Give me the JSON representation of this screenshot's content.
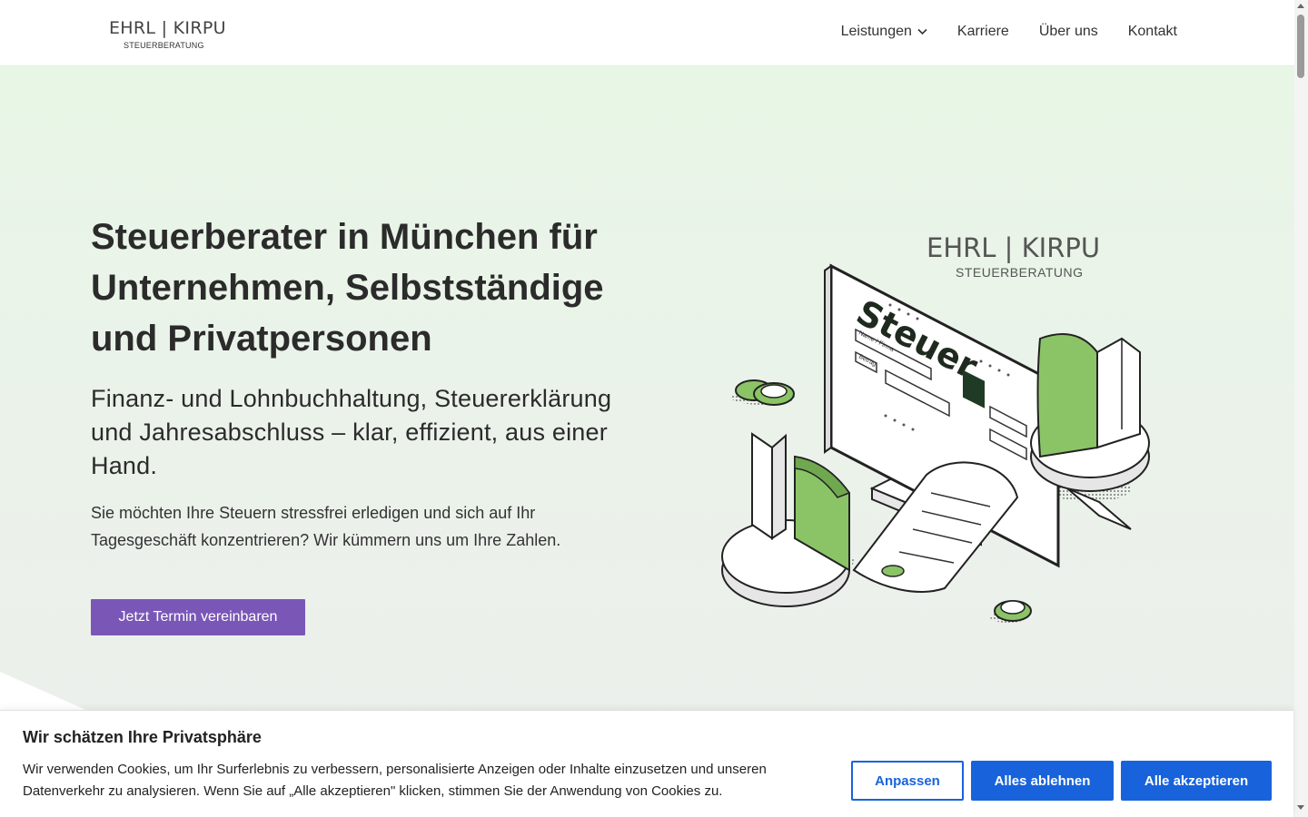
{
  "header": {
    "logo_name": "EHRL | KIRPU",
    "logo_sub": "STEUERBERATUNG",
    "nav": [
      {
        "label": "Leistungen",
        "has_dropdown": true
      },
      {
        "label": "Karriere"
      },
      {
        "label": "Über uns"
      },
      {
        "label": "Kontakt"
      }
    ]
  },
  "hero": {
    "title": "Steuerberater in München für Unternehmen, Selbstständige und Privatpersonen",
    "subtitle": "Finanz- und Lohnbuchhaltung, Steuererklärung und Jahresabschluss – klar, effizient, aus einer Hand.",
    "lead": "Sie möchten Ihre Steuern stressfrei erledigen und sich auf Ihr Tagesgeschäft konzentrieren? Wir kümmern uns um Ihre Zahlen.",
    "cta": "Jetzt Termin vereinbaren",
    "illustration": {
      "brand": "EHRL | KIRPU",
      "brand_sub": "STEUERBERATUNG",
      "screen_word": "Steuer",
      "field1": "Name / Firma",
      "field2": "Betrag"
    }
  },
  "cookie": {
    "title": "Wir schätzen Ihre Privatsphäre",
    "text": "Wir verwenden Cookies, um Ihr Surferlebnis zu verbessern, personalisierte Anzeigen oder Inhalte einzusetzen und unseren Datenverkehr zu analysieren. Wenn Sie auf „Alle akzeptieren\" klicken, stimmen Sie der Anwendung von Cookies zu.",
    "buttons": {
      "customize": "Anpassen",
      "reject": "Alles ablehnen",
      "accept": "Alle akzeptieren"
    }
  },
  "colors": {
    "accent_purple": "#7a57b7",
    "cookie_blue": "#1863dc",
    "illustration_green": "#8bc467",
    "hero_bg": "#e8f6e6"
  }
}
